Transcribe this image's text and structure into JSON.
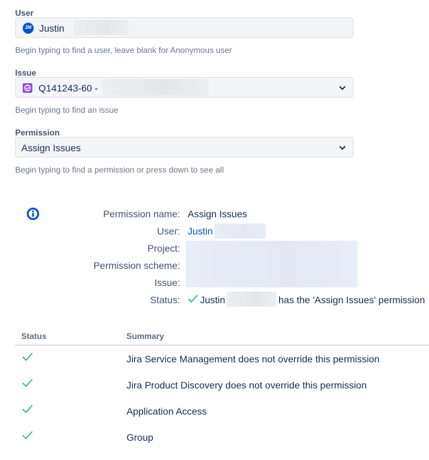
{
  "form": {
    "user": {
      "label": "User",
      "avatar_initials": "JM",
      "value": "Justin",
      "help": "Begin typing to find a user, leave blank for Anonymous user"
    },
    "issue": {
      "label": "Issue",
      "value": "Q141243-60 -",
      "help": "Begin typing to find an issue"
    },
    "permission": {
      "label": "Permission",
      "value": "Assign Issues",
      "help": "Begin typing to find a permission or press down to see all"
    }
  },
  "result": {
    "info_icon": "info-icon",
    "permission_name_label": "Permission name:",
    "permission_name_value": "Assign Issues",
    "user_label": "User:",
    "user_value": "Justin",
    "project_label": "Project:",
    "scheme_label": "Permission scheme:",
    "issue_label": "Issue:",
    "status_label": "Status:",
    "status_user": "Justin",
    "status_text": "has the 'Assign Issues' permission",
    "status_color": "#36b37e"
  },
  "table": {
    "headers": [
      "Status",
      "Summary"
    ],
    "rows": [
      {
        "status_icon": "check-icon",
        "summary": "Jira Service Management does not override this permission"
      },
      {
        "status_icon": "check-icon",
        "summary": "Jira Product Discovery does not override this permission"
      },
      {
        "status_icon": "check-icon",
        "summary": "Application Access"
      },
      {
        "status_icon": "check-icon",
        "summary": "Group"
      }
    ]
  },
  "colors": {
    "link": "#0052cc",
    "check": "#36b37e",
    "issue_icon": "#904ee2",
    "avatar": "#0052cc"
  }
}
